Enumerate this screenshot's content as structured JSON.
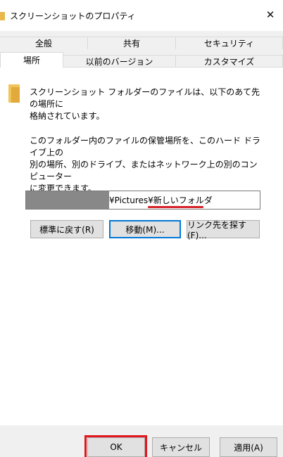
{
  "window": {
    "title": "スクリーンショットのプロパティ",
    "close_glyph": "✕"
  },
  "tabs": {
    "row1": [
      "全般",
      "共有",
      "セキュリティ"
    ],
    "row2": [
      "場所",
      "以前のバージョン",
      "カスタマイズ"
    ],
    "active": "場所"
  },
  "location": {
    "description1_line1": "スクリーンショット フォルダーのファイルは、以下のあて先の場所に",
    "description1_line2": "格納されています。",
    "description2_line1": "このフォルダー内のファイルの保管場所を、このハード ドライブ上の",
    "description2_line2": "別の場所、別のドライブ、またはネットワーク上の別のコンピューター",
    "description2_line3": "に変更できます。",
    "path_visible": "¥Pictures¥新しいフォルダ",
    "highlight_color": "#d8232a"
  },
  "buttons": {
    "restore_default": "標準に戻す(R)",
    "move": "移動(M)...",
    "find_target": "リンク先を探す(F)..."
  },
  "footer": {
    "ok": "OK",
    "cancel": "キャンセル",
    "apply": "適用(A)"
  }
}
